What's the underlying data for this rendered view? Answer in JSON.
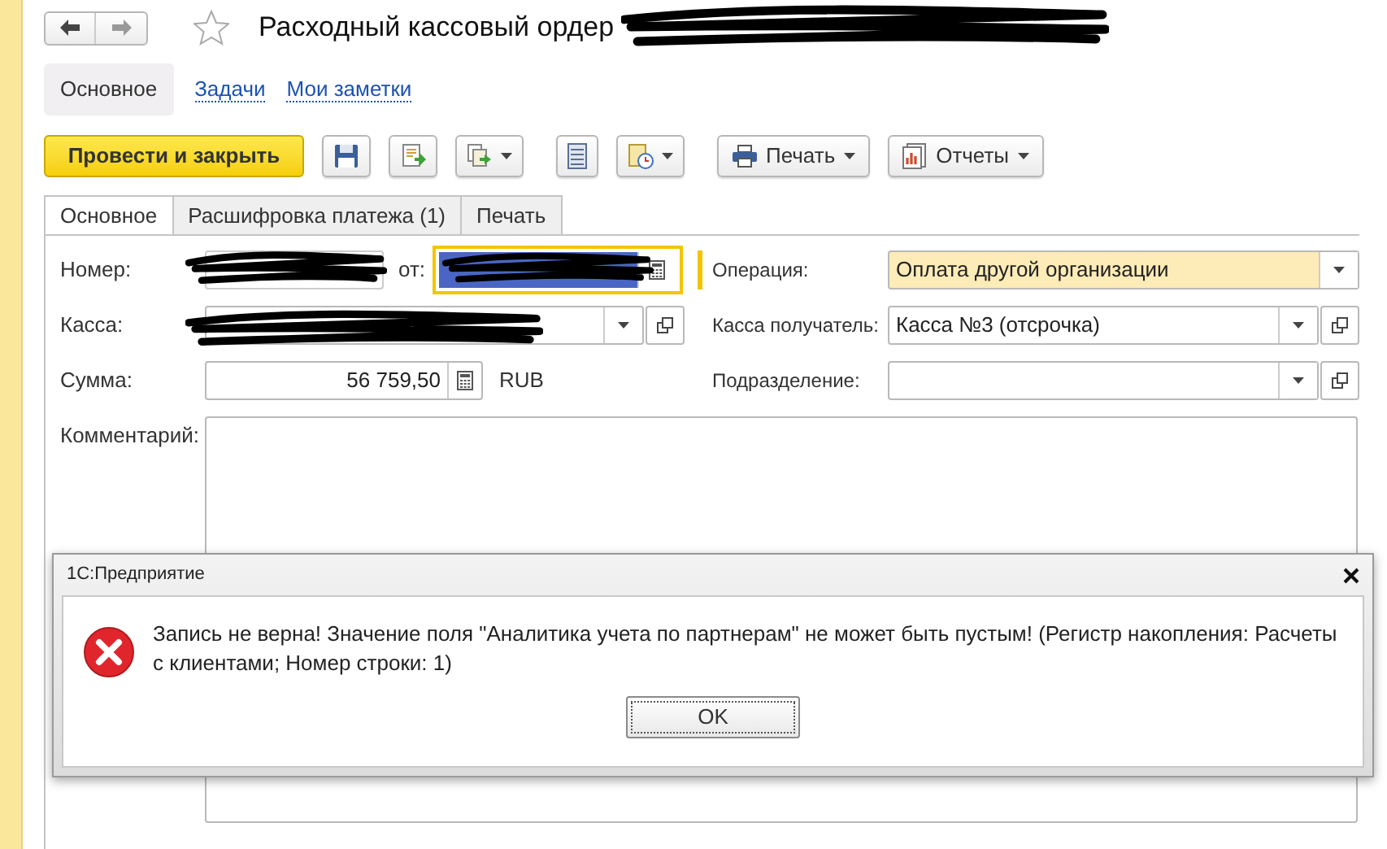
{
  "title": "Расходный кассовый ордер",
  "section_tabs": [
    {
      "label": "Основное",
      "selected": true
    },
    {
      "label": "Задачи",
      "selected": false
    },
    {
      "label": "Мои заметки",
      "selected": false
    }
  ],
  "toolbar": [
    {
      "kind": "primary",
      "label": "Провести и закрыть"
    },
    {
      "kind": "icon",
      "dropdown": false
    },
    {
      "kind": "icon",
      "dropdown": false
    },
    {
      "kind": "icon",
      "dropdown": true
    },
    {
      "kind": "icon",
      "dropdown": false
    },
    {
      "kind": "icon",
      "dropdown": true
    },
    {
      "kind": "labeled",
      "label": "Печать",
      "dropdown": true
    },
    {
      "kind": "labeled",
      "label": "Отчеты",
      "dropdown": true
    }
  ],
  "tabs": [
    {
      "label": "Основное",
      "selected": true
    },
    {
      "label": "Расшифровка платежа (1)",
      "selected": false
    },
    {
      "label": "Печать",
      "selected": false
    }
  ],
  "left_fields": [
    {
      "kind": "number_date",
      "label": "Номер:",
      "date_label": "от:"
    },
    {
      "kind": "select",
      "label": "Касса:"
    },
    {
      "kind": "amount",
      "label": "Сумма:",
      "value": "56 759,50",
      "currency": "RUB"
    }
  ],
  "right_fields": [
    {
      "label": "Операция:",
      "value": "Оплата другой организации",
      "highlighted": true,
      "open_button": false
    },
    {
      "label": "Касса получатель:",
      "value": "Касса №3 (отсрочка)",
      "highlighted": false,
      "open_button": true
    },
    {
      "label": "Подразделение:",
      "highlighted": false,
      "open_button": true
    }
  ],
  "comment": {
    "label": "Комментарий:"
  },
  "dialog": {
    "title": "1С:Предприятие",
    "message": "Запись не верна! Значение поля \"Аналитика учета по партнерам\" не может быть пустым! (Регистр накопления: Расчеты с клиентами; Номер строки: 1)",
    "button": "OK"
  }
}
